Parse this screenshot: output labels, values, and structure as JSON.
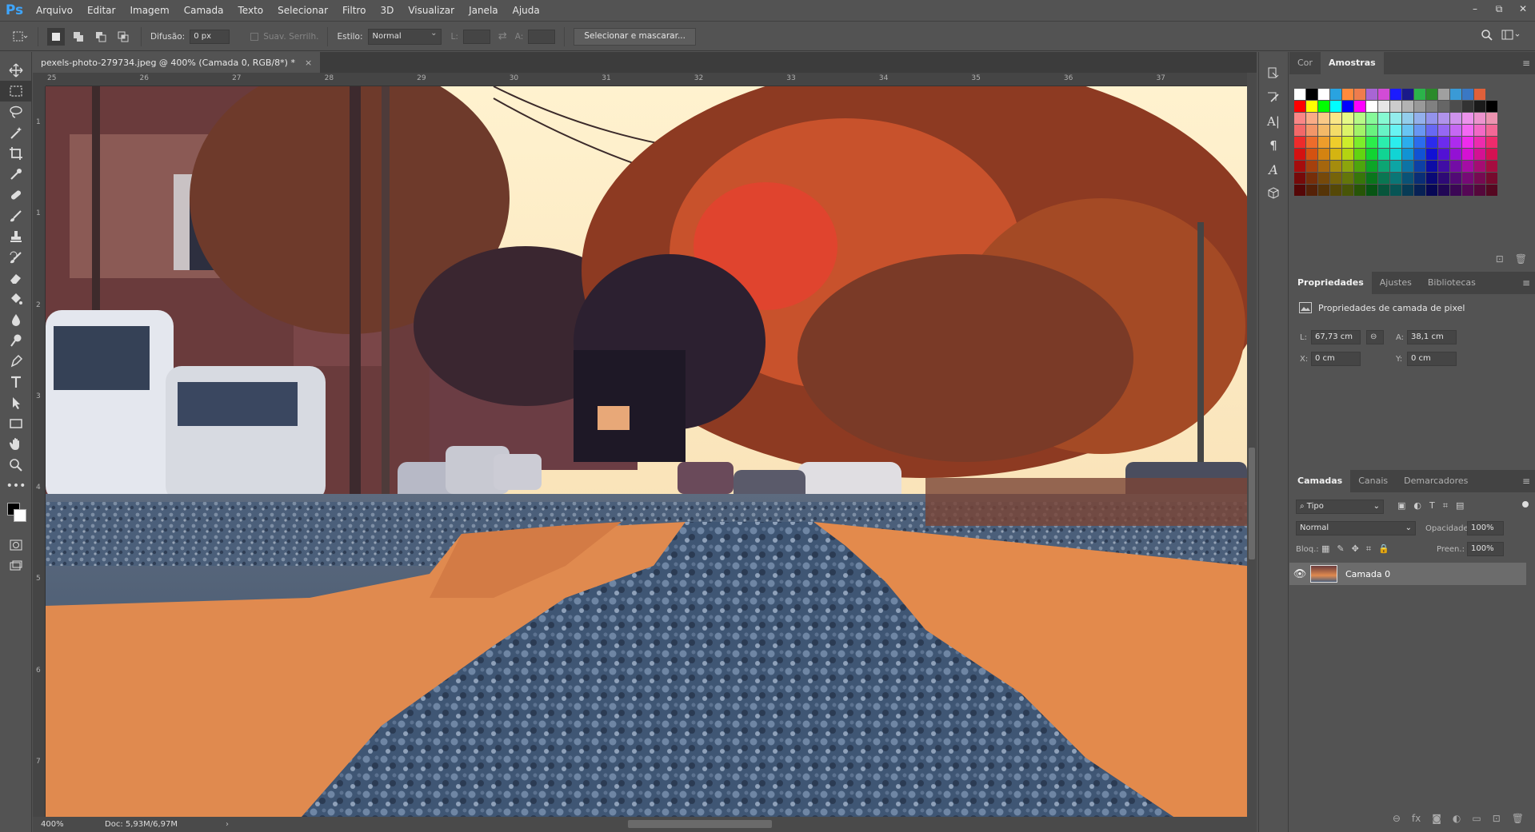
{
  "app": {
    "logo": "Ps"
  },
  "menu": [
    "Arquivo",
    "Editar",
    "Imagem",
    "Camada",
    "Texto",
    "Selecionar",
    "Filtro",
    "3D",
    "Visualizar",
    "Janela",
    "Ajuda"
  ],
  "window_controls": {
    "minimize": "–",
    "restore": "⧉",
    "close": "✕"
  },
  "options": {
    "feather_label": "Difusão:",
    "feather_value": "0 px",
    "antialias_label": "Suav. Serrilh.",
    "style_label": "Estilo:",
    "style_value": "Normal",
    "width_label": "L:",
    "height_label": "A:",
    "select_mask_button": "Selecionar e mascarar..."
  },
  "document": {
    "tab_title": "pexels-photo-279734.jpeg @ 400% (Camada 0, RGB/8*) *",
    "close_glyph": "×",
    "zoom": "400%",
    "doc_size": "Doc: 5,93M/6,97M",
    "ruler_top": [
      "25",
      "26",
      "27",
      "28",
      "29",
      "30",
      "31",
      "32",
      "33",
      "34",
      "35",
      "36",
      "37"
    ],
    "ruler_left": [
      "1",
      "1",
      "2",
      "3",
      "4",
      "5",
      "6",
      "7"
    ]
  },
  "swatches_panel": {
    "tabs": [
      "Cor",
      "Amostras"
    ],
    "active_tab": "Amostras"
  },
  "properties_panel": {
    "tabs": [
      "Propriedades",
      "Ajustes",
      "Bibliotecas"
    ],
    "active_tab": "Propriedades",
    "title": "Propriedades de camada de pixel",
    "w_label": "L:",
    "w_value": "67,73 cm",
    "h_label": "A:",
    "h_value": "38,1 cm",
    "x_label": "X:",
    "x_value": "0 cm",
    "y_label": "Y:",
    "y_value": "0 cm"
  },
  "layers_panel": {
    "tabs": [
      "Camadas",
      "Canais",
      "Demarcadores"
    ],
    "active_tab": "Camadas",
    "filter_kind": "Tipo",
    "blend_mode": "Normal",
    "opacity_label": "Opacidade:",
    "opacity_value": "100%",
    "lock_label": "Bloq.:",
    "fill_label": "Preen.:",
    "fill_value": "100%",
    "layers": [
      {
        "name": "Camada 0",
        "visible": true
      }
    ]
  },
  "colors": {
    "accent": "#3ea6ff",
    "panel": "#535353",
    "dark_panel": "#434343"
  }
}
